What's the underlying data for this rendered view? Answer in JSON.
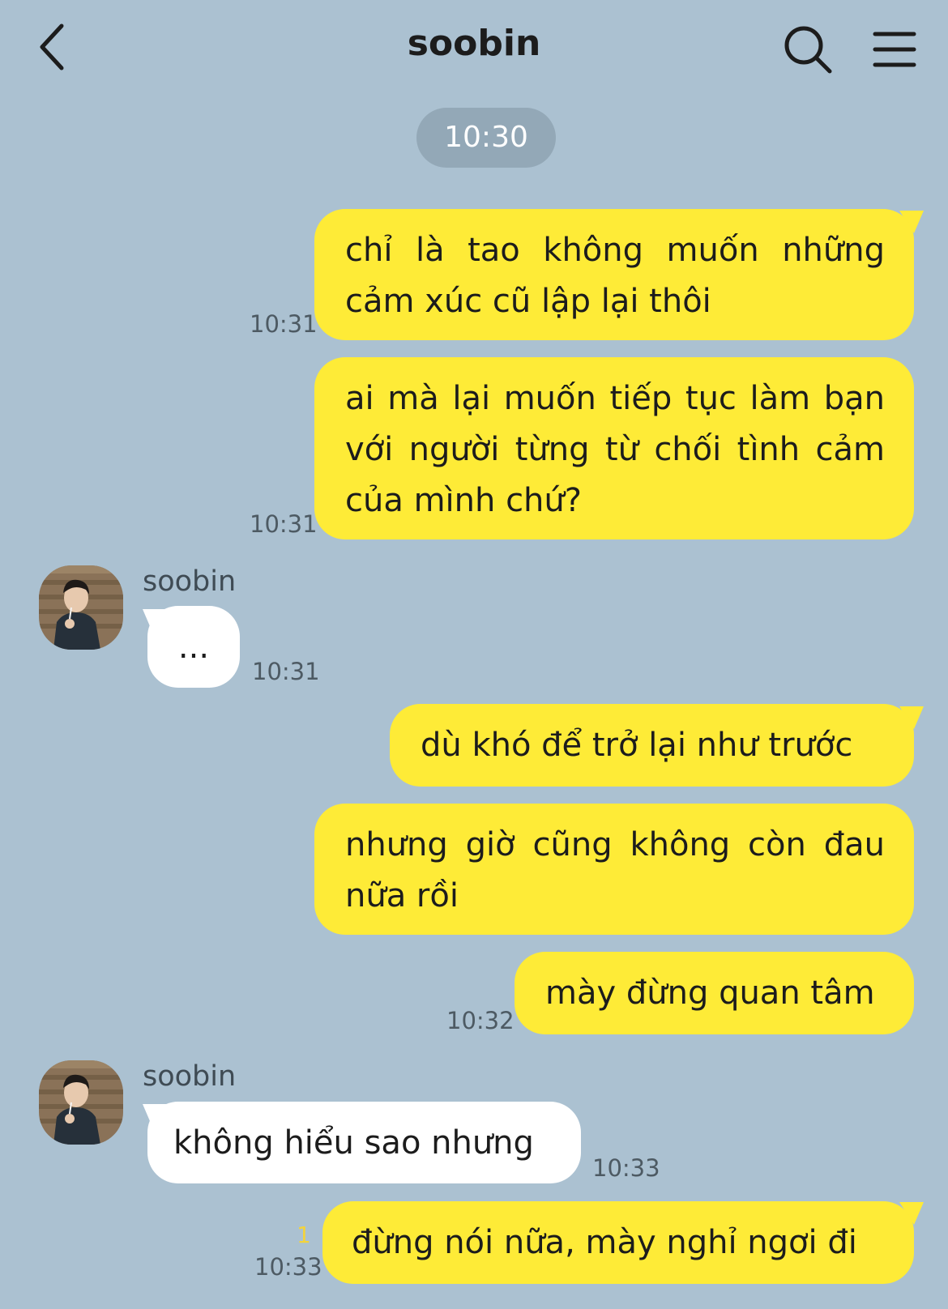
{
  "header": {
    "title": "soobin",
    "back_icon": "chevron-left-icon",
    "search_icon": "search-icon",
    "menu_icon": "hamburger-menu-icon"
  },
  "date_separator": "10:30",
  "messages": [
    {
      "from": "me",
      "text": "chỉ là tao không muốn những cảm xúc cũ lập lại thôi",
      "time": "10:31"
    },
    {
      "from": "me",
      "text": "ai mà lại muốn tiếp tục làm bạn với người từng từ chối tình cảm của mình chứ?",
      "time": "10:31"
    },
    {
      "from": "soobin",
      "sender": "soobin",
      "text": "...",
      "time": "10:31"
    },
    {
      "from": "me",
      "text": "dù khó để trở lại như trước",
      "time": ""
    },
    {
      "from": "me",
      "text": "nhưng giờ cũng không còn đau nữa rồi",
      "time": ""
    },
    {
      "from": "me",
      "text": "mày đừng quan tâm",
      "time": "10:32"
    },
    {
      "from": "soobin",
      "sender": "soobin",
      "text": "không hiểu sao nhưng",
      "time": "10:33"
    },
    {
      "from": "me",
      "text": "đừng nói nữa, mày nghỉ ngơi đi",
      "time": "10:33",
      "unread": "1"
    }
  ],
  "colors": {
    "background": "#abc1d1",
    "my_bubble": "#feeb37",
    "their_bubble": "#ffffff",
    "time_pill": "#93a8b7",
    "unread_count": "#f3d33c"
  }
}
